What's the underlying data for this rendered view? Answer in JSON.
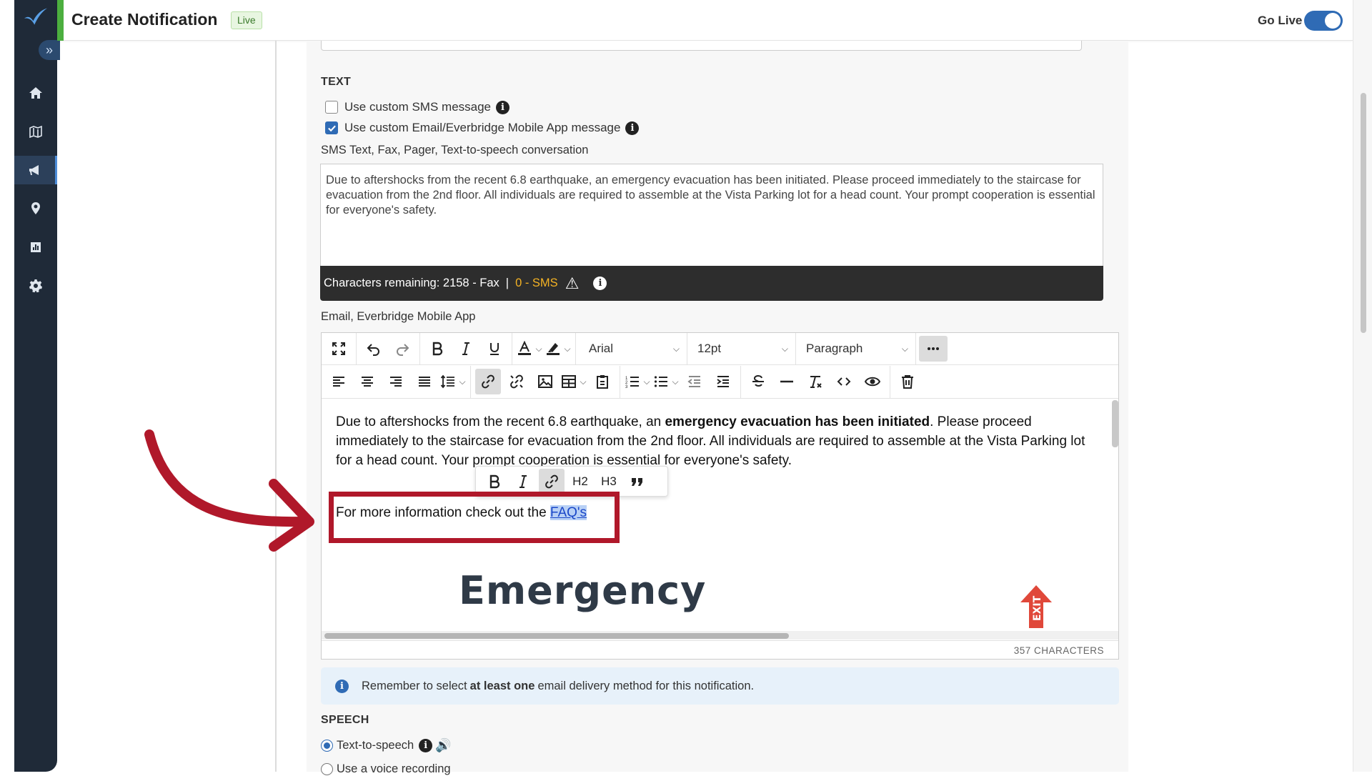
{
  "header": {
    "title": "Create Notification",
    "status_badge": "Live",
    "go_live_label": "Go Live",
    "go_live_on": true
  },
  "sidebar": {
    "items": [
      {
        "name": "home",
        "icon": "home-icon"
      },
      {
        "name": "map",
        "icon": "map-icon"
      },
      {
        "name": "notifications",
        "icon": "megaphone-icon",
        "active": true
      },
      {
        "name": "locations",
        "icon": "location-pin-icon"
      },
      {
        "name": "reports",
        "icon": "chart-icon"
      },
      {
        "name": "settings",
        "icon": "gear-icon"
      }
    ]
  },
  "text_section": {
    "heading": "TEXT",
    "custom_sms": {
      "label": "Use custom SMS message",
      "checked": false
    },
    "custom_email": {
      "label": "Use custom Email/Everbridge Mobile App message",
      "checked": true
    },
    "sms_label": "SMS Text, Fax, Pager, Text-to-speech conversation",
    "sms_text": "Due to aftershocks from the recent 6.8 earthquake, an emergency evacuation has been initiated. Please proceed immediately to the staircase for evacuation from the 2nd floor. All individuals are required to assemble at the Vista Parking lot for a head count. Your prompt cooperation is essential for everyone's safety.",
    "chars_remaining": "Characters remaining: 2158 - Fax",
    "separator": "|",
    "sms_count": "0 - SMS"
  },
  "email_editor": {
    "label": "Email, Everbridge Mobile App",
    "font_family": "Arial",
    "font_size": "12pt",
    "block_format": "Paragraph",
    "paragraph_part1": "Due to aftershocks from the recent 6.8 earthquake, an ",
    "paragraph_bold": "emergency evacuation has been initiated",
    "paragraph_part2": ". Please proceed immediately to the staircase for evacuation from the 2nd floor. All individuals are required to assemble at the Vista Parking lot for a head count. Your prompt cooperation is essential for everyone's safety.",
    "more_info_text": "For more information check out the ",
    "link_text": "FAQ's",
    "image_text": "Emergency",
    "exit_sign_text": "EXIT",
    "char_count": "357 CHARACTERS",
    "quick_toolbar": {
      "h2": "H2",
      "h3": "H3"
    }
  },
  "notice": {
    "prefix": "Remember to select ",
    "bold": "at least one",
    "suffix": " email delivery method for this notification."
  },
  "speech_section": {
    "heading": "SPEECH",
    "options": [
      {
        "label": "Text-to-speech",
        "checked": true
      },
      {
        "label": "Use a voice recording",
        "checked": false
      }
    ]
  },
  "colors": {
    "sidebar": "#1f2a38",
    "accent": "#2f6bb5",
    "live_green": "#4caf3f",
    "highlight_red": "#b0182a",
    "sms_warning": "#f5b324"
  }
}
